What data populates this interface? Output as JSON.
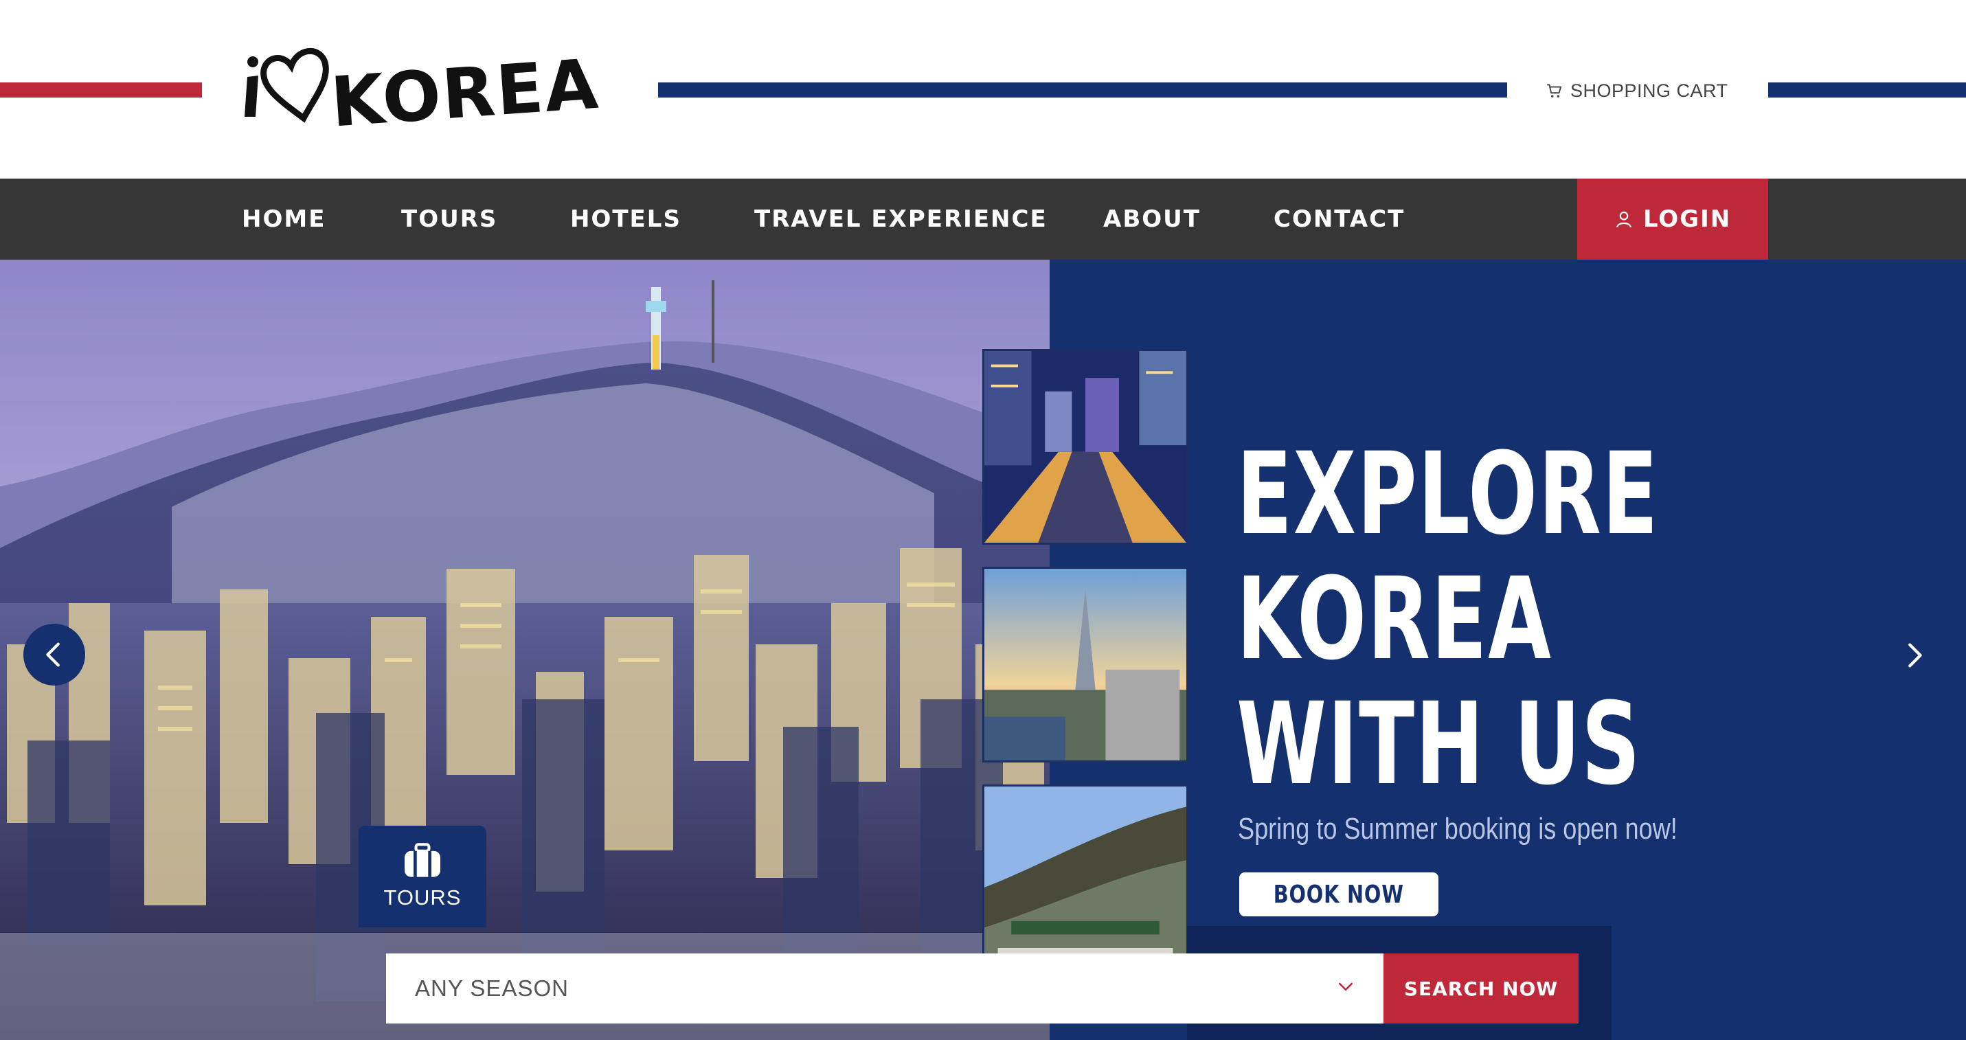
{
  "brand": {
    "logo_text": "I ♥ KOREA",
    "colors": {
      "red": "#be2838",
      "navy": "#14306e",
      "nav_bg": "#363636"
    }
  },
  "header": {
    "cart_label": "SHOPPING CART",
    "cart_icon": "cart-icon"
  },
  "nav": {
    "items": [
      {
        "label": "HOME"
      },
      {
        "label": "TOURS"
      },
      {
        "label": "HOTELS"
      },
      {
        "label": "TRAVEL EXPERIENCE"
      },
      {
        "label": "ABOUT"
      },
      {
        "label": "CONTACT"
      }
    ],
    "login_label": "LOGIN",
    "login_icon": "user-icon"
  },
  "hero": {
    "headline": [
      "EXPLORE",
      "KOREA",
      "WITH US"
    ],
    "subline": "Spring to Summer booking is open now!",
    "cta_label": "BOOK NOW",
    "prev_icon": "chevron-left-icon",
    "next_icon": "chevron-right-icon"
  },
  "search": {
    "tab_label": "TOURS",
    "tab_icon": "suitcase-icon",
    "season_value": "ANY SEASON",
    "submit_label": "SEARCH NOW"
  }
}
